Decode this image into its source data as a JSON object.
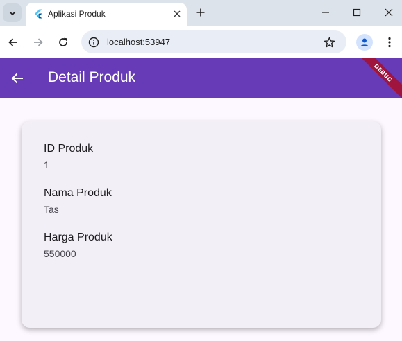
{
  "browser": {
    "tab_title": "Aplikasi Produk",
    "url": "localhost:53947"
  },
  "appbar": {
    "title": "Detail Produk",
    "color": "#673ab7",
    "debug_banner": "DEBUG"
  },
  "fields": [
    {
      "label": "ID Produk",
      "value": "1"
    },
    {
      "label": "Nama Produk",
      "value": "Tas"
    },
    {
      "label": "Harga Produk",
      "value": "550000"
    }
  ],
  "icons": {
    "tab_search": "chevron-down-icon",
    "favicon": "flutter-logo",
    "tab_close": "close-icon",
    "new_tab": "plus-icon",
    "minimize": "minimize-icon",
    "maximize": "maximize-icon",
    "close_window": "close-icon",
    "back": "arrow-left-icon",
    "forward": "arrow-right-icon",
    "reload": "reload-icon",
    "site_info": "info-icon",
    "bookmark": "star-icon",
    "profile": "person-icon",
    "menu": "more-vert-icon",
    "app_back": "arrow-left-icon"
  }
}
